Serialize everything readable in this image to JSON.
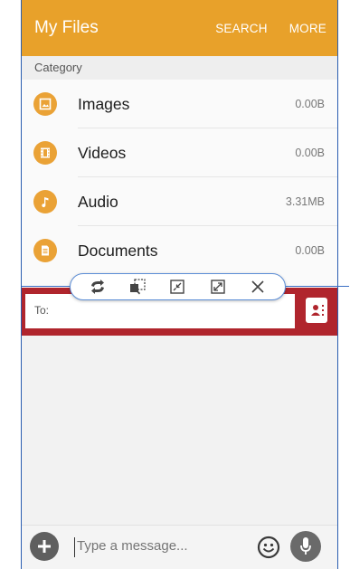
{
  "files_app": {
    "title": "My Files",
    "actions": [
      "SEARCH",
      "MORE"
    ],
    "category_header": "Category",
    "categories": [
      {
        "label": "Images",
        "size": "0.00B",
        "icon": "image-icon"
      },
      {
        "label": "Videos",
        "size": "0.00B",
        "icon": "film-icon"
      },
      {
        "label": "Audio",
        "size": "3.31MB",
        "icon": "music-note-icon"
      },
      {
        "label": "Documents",
        "size": "0.00B",
        "icon": "document-icon"
      }
    ],
    "accent": "#e8a12a"
  },
  "multiwindow_toolbar": {
    "buttons": [
      "switch-windows-icon",
      "drag-and-drop-icon",
      "minimize-window-icon",
      "maximize-window-icon",
      "close-icon"
    ]
  },
  "messages_app": {
    "to_label": "To:",
    "message_placeholder": "Type a message...",
    "accent": "#b0252d"
  }
}
